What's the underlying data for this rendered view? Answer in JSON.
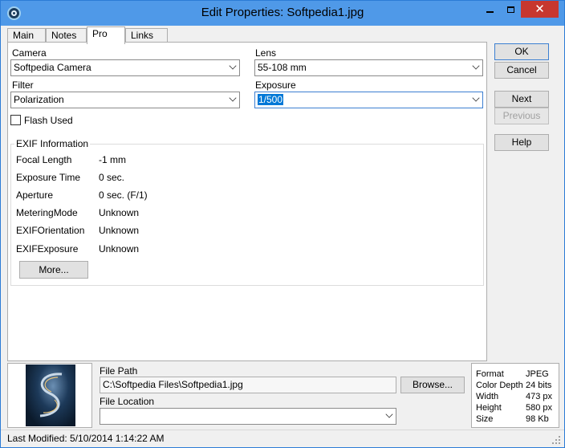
{
  "window": {
    "title": "Edit Properties: Softpedia1.jpg",
    "close_glyph": "✕"
  },
  "tabs": [
    {
      "label": "Main"
    },
    {
      "label": "Notes"
    },
    {
      "label": "Pro"
    },
    {
      "label": "Links"
    }
  ],
  "pro": {
    "camera": {
      "label": "Camera",
      "value": "Softpedia Camera"
    },
    "lens": {
      "label": "Lens",
      "value": "55-108 mm"
    },
    "filter": {
      "label": "Filter",
      "value": "Polarization"
    },
    "exposure": {
      "label": "Exposure",
      "value": "1/500"
    },
    "flash": {
      "label": "Flash Used",
      "checked": false
    }
  },
  "exif": {
    "title": "EXIF Information",
    "rows": [
      {
        "key": "Focal Length",
        "value": "-1 mm"
      },
      {
        "key": "Exposure Time",
        "value": "0 sec."
      },
      {
        "key": "Aperture",
        "value": "0 sec. (F/1)"
      },
      {
        "key": "MeteringMode",
        "value": "Unknown"
      },
      {
        "key": "EXIFOrientation",
        "value": "Unknown"
      },
      {
        "key": "EXIFExposure",
        "value": "Unknown"
      }
    ],
    "more_label": "More..."
  },
  "buttons": {
    "ok": "OK",
    "cancel": "Cancel",
    "next": "Next",
    "previous": "Previous",
    "help": "Help"
  },
  "file": {
    "path_label": "File Path",
    "path_value": "C:\\Softpedia Files\\Softpedia1.jpg",
    "browse_label": "Browse...",
    "location_label": "File Location",
    "location_value": ""
  },
  "image_info": {
    "rows": [
      {
        "key": "Format",
        "value": "JPEG"
      },
      {
        "key": "Color Depth",
        "value": "24 bits"
      },
      {
        "key": "Width",
        "value": "473 px"
      },
      {
        "key": "Height",
        "value": "580 px"
      },
      {
        "key": "Size",
        "value": "98 Kb"
      }
    ]
  },
  "status": {
    "text": "Last Modified: 5/10/2014 1:14:22 AM"
  },
  "colors": {
    "titlebar": "#4f99e8",
    "close_button": "#c7372f",
    "selection": "#0078d7"
  }
}
